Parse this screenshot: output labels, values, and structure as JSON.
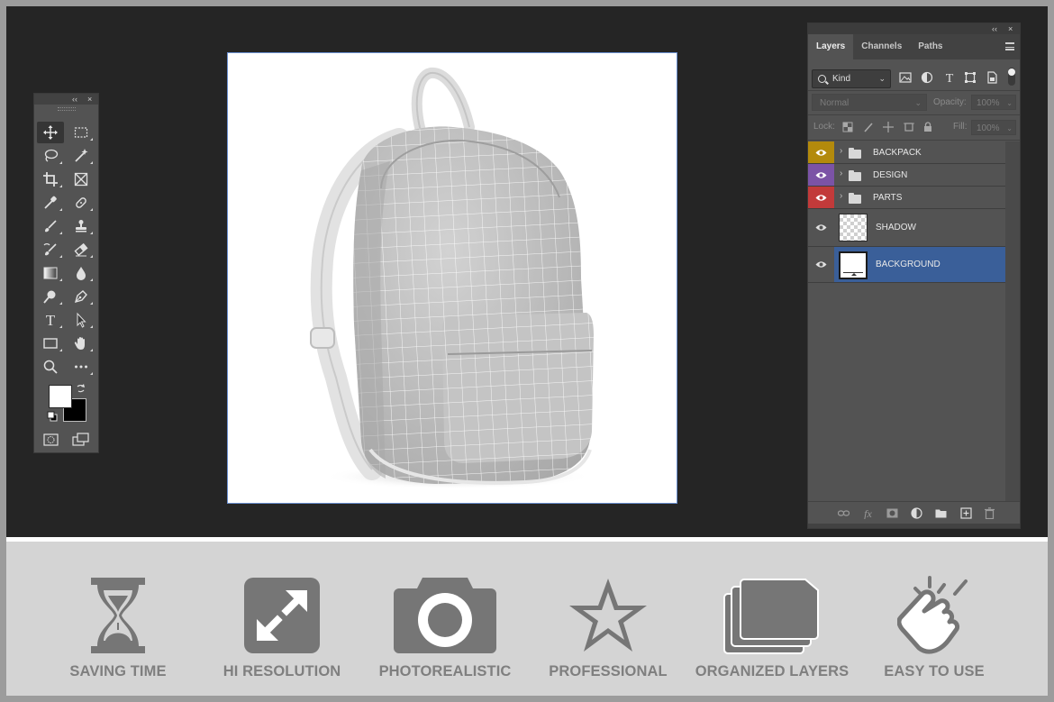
{
  "toolbox": {
    "collapse_glyph": "‹‹",
    "close_glyph": "×",
    "tools": [
      {
        "name": "move-tool-icon",
        "active": true
      },
      {
        "name": "marquee-tool-icon"
      },
      {
        "name": "lasso-tool-icon"
      },
      {
        "name": "magic-wand-tool-icon"
      },
      {
        "name": "crop-tool-icon"
      },
      {
        "name": "frame-tool-icon"
      },
      {
        "name": "eyedropper-tool-icon"
      },
      {
        "name": "healing-brush-tool-icon"
      },
      {
        "name": "brush-tool-icon"
      },
      {
        "name": "clone-stamp-tool-icon"
      },
      {
        "name": "history-brush-tool-icon"
      },
      {
        "name": "eraser-tool-icon"
      },
      {
        "name": "gradient-tool-icon"
      },
      {
        "name": "blur-tool-icon"
      },
      {
        "name": "dodge-tool-icon"
      },
      {
        "name": "pen-tool-icon"
      },
      {
        "name": "type-tool-icon"
      },
      {
        "name": "path-selection-tool-icon"
      },
      {
        "name": "rectangle-tool-icon"
      },
      {
        "name": "hand-tool-icon"
      },
      {
        "name": "zoom-tool-icon"
      },
      {
        "name": "more-tools-icon"
      }
    ],
    "foreground_color": "#ffffff",
    "background_color": "#000000"
  },
  "canvas": {
    "image": "backpack-mockup-image"
  },
  "layers_panel": {
    "collapse_glyph": "‹‹",
    "close_glyph": "×",
    "tabs": [
      "Layers",
      "Channels",
      "Paths"
    ],
    "active_tab": "Layers",
    "filter_label": "Kind",
    "blend_mode": "Normal",
    "opacity_label": "Opacity:",
    "opacity_value": "100%",
    "lock_label": "Lock:",
    "fill_label": "Fill:",
    "fill_value": "100%",
    "layers": [
      {
        "name": "BACKPACK",
        "type": "group",
        "color": "#b38a0c"
      },
      {
        "name": "DESIGN",
        "type": "group",
        "color": "#7b53a6"
      },
      {
        "name": "PARTS",
        "type": "group",
        "color": "#c23a3a"
      },
      {
        "name": "SHADOW",
        "type": "layer",
        "thumbnail": "transparent"
      },
      {
        "name": "BACKGROUND",
        "type": "layer",
        "thumbnail": "white",
        "selected": true
      }
    ]
  },
  "features": [
    {
      "label": "SAVING TIME",
      "icon": "hourglass-icon"
    },
    {
      "label": "HI RESOLUTION",
      "icon": "expand-arrows-icon"
    },
    {
      "label": "PHOTOREALISTIC",
      "icon": "camera-icon"
    },
    {
      "label": "PROFESSIONAL",
      "icon": "star-icon"
    },
    {
      "label": "ORGANIZED LAYERS",
      "icon": "stacked-folders-icon"
    },
    {
      "label": "EASY TO USE",
      "icon": "tap-hand-icon"
    }
  ],
  "colors": {
    "workspace": "#252525",
    "panel": "#535353",
    "selected_layer": "#3a5f99",
    "feature_bg": "#d4d4d4",
    "feature_text": "#7f7f7f"
  }
}
